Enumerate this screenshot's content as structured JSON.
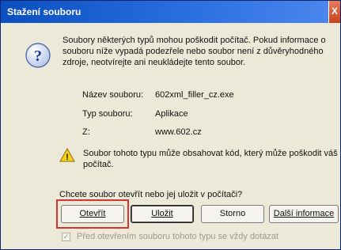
{
  "window": {
    "title": "Stažení souboru",
    "close_label": "X"
  },
  "info_text": "Soubory některých typů mohou poškodit počítač. Pokud informace o souboru níže vypadá podezřele nebo soubor není z důvěryhodného zdroje, neotvírejte ani neukládejte tento soubor.",
  "file": {
    "name_label": "Název souboru:",
    "name_value": "602xml_filler_cz.exe",
    "type_label": "Typ souboru:",
    "type_value": "Aplikace",
    "from_label": "Z:",
    "from_value": "www.602.cz"
  },
  "warning_text": "Soubor tohoto typu může obsahovat kód, který může poškodit váš počítač.",
  "question": "Chcete soubor otevřít nebo jej uložit v počítači?",
  "buttons": {
    "open": "Otevřít",
    "save": "Uložit",
    "cancel": "Storno",
    "more": "Další informace"
  },
  "checkbox": {
    "label": "Před otevřením souboru tohoto typu se vždy dotázat",
    "checked": true
  },
  "icons": {
    "question": "question-icon",
    "warning": "warning-icon",
    "close": "close-icon"
  }
}
